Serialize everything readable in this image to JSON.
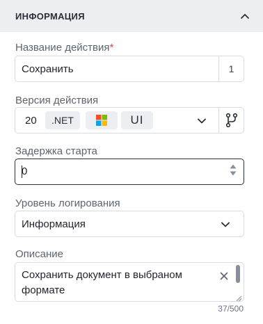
{
  "section": {
    "title": "ИНФОРМАЦИЯ",
    "collapse_icon": "chevron-up-icon"
  },
  "action_name": {
    "label": "Название действия",
    "required_mark": "*",
    "value": "Сохранить",
    "counter": "1"
  },
  "action_version": {
    "label": "Версия действия",
    "number": "20",
    "framework": ".NET",
    "platform_icon": "windows-icon",
    "ui_tag": "UI",
    "dropdown_icon": "chevron-down-icon",
    "branch_icon": "branch-icon"
  },
  "start_delay": {
    "label": "Задержка старта",
    "value": "0"
  },
  "log_level": {
    "label": "Уровень логирования",
    "value": "Информация",
    "dropdown_icon": "chevron-down-icon"
  },
  "description": {
    "label": "Описание",
    "value": "Сохранить документ в выбраном формате",
    "counter": "37/500",
    "clear_icon": "close-icon"
  },
  "colors": {
    "required": "#e5484d",
    "header_bg": "#eceef1",
    "border": "#d7dbe0",
    "focus_border": "#2a2f36"
  }
}
